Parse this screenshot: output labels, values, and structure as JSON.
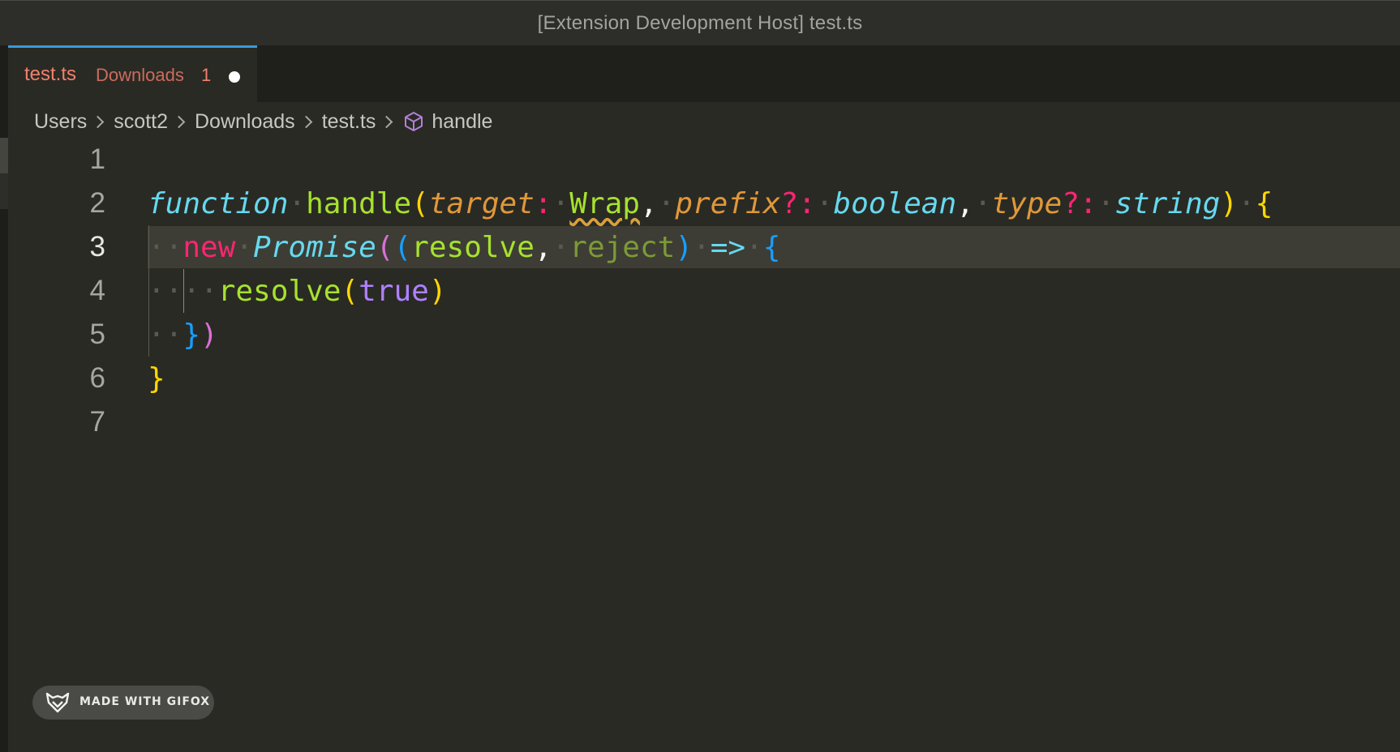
{
  "window": {
    "title": "[Extension Development Host] test.ts"
  },
  "tab": {
    "name": "test.ts",
    "description": "Downloads",
    "problem_count": "1",
    "dirty": true
  },
  "breadcrumb": {
    "items": [
      "Users",
      "scott2",
      "Downloads",
      "test.ts",
      "handle"
    ],
    "symbol_icon": "symbol-method-icon"
  },
  "editor": {
    "active_line": 3,
    "line_numbers": [
      "1",
      "2",
      "3",
      "4",
      "5",
      "6",
      "7"
    ],
    "lines": [
      "",
      "function handle(target: Wrap, prefix?: boolean, type?: string) {",
      "  new Promise((resolve, reject) => {",
      "    resolve(true)",
      "  })",
      "}",
      ""
    ],
    "tokens": {
      "l2": {
        "kw": "function",
        "name": "handle",
        "open": "(",
        "p1": "target",
        "colon1": ":",
        "t1": "Wrap",
        "comma1": ",",
        "p2": "prefix",
        "opt2": "?:",
        "t2": "boolean",
        "comma2": ",",
        "p3": "type",
        "opt3": "?:",
        "t3": "string",
        "close": ")",
        "brace": "{"
      },
      "l3": {
        "kw": "new",
        "cls": "Promise",
        "open1": "(",
        "open2": "(",
        "a1": "resolve",
        "comma": ",",
        "a2": "reject",
        "close2": ")",
        "arrow": "=>",
        "brace": "{"
      },
      "l4": {
        "call": "resolve",
        "open": "(",
        "arg": "true",
        "close": ")"
      },
      "l5": {
        "brace": "}",
        "paren": ")"
      },
      "l6": {
        "brace": "}"
      }
    },
    "colors": {
      "keyword_fn": "#66d9ef",
      "function_name": "#a6e22e",
      "parameter": "#e0983a",
      "operator": "#f92672",
      "bracket_level1": "#ffd700",
      "bracket_level2": "#da70d6",
      "bracket_level3": "#179fff",
      "boolean": "#ae81ff",
      "error_squiggle": "#d9a13b",
      "tab_active_border": "#3a9ad9",
      "tab_error_text": "#f0816d"
    }
  },
  "watermark": {
    "label": "MADE WITH GIFOX",
    "icon": "fox-icon"
  }
}
